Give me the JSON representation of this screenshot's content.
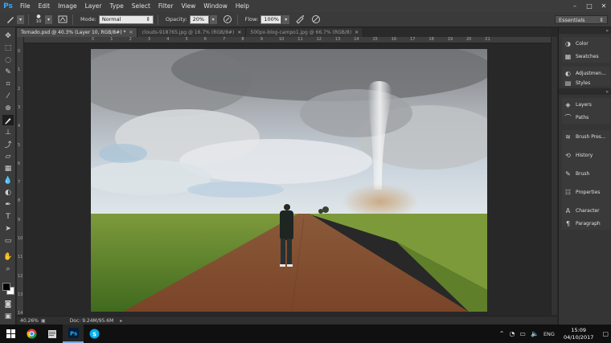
{
  "app": {
    "logo": "Ps"
  },
  "menu": [
    "File",
    "Edit",
    "Image",
    "Layer",
    "Type",
    "Select",
    "Filter",
    "View",
    "Window",
    "Help"
  ],
  "window_controls": [
    "minimize-icon",
    "maximize-icon",
    "close-icon"
  ],
  "options": {
    "brush_size": "10",
    "mode_label": "Mode:",
    "mode_value": "Normal",
    "opacity_label": "Opacity:",
    "opacity_value": "20%",
    "flow_label": "Flow:",
    "flow_value": "100%",
    "workspace": "Essentials"
  },
  "tabs": [
    {
      "label": "Tornado.psd @ 40.3% (Layer 10, RGB/8#) *",
      "active": true
    },
    {
      "label": "clouds-918765.jpg @ 16.7% (RGB/8#)",
      "active": false
    },
    {
      "label": "500px-blog-campo1.jpg @ 66.7% (RGB/8)",
      "active": false
    }
  ],
  "ruler_labels": [
    "0",
    "1",
    "2",
    "3",
    "4",
    "5",
    "6",
    "7",
    "8",
    "9",
    "10",
    "11",
    "12",
    "13",
    "14",
    "15",
    "16",
    "17",
    "18",
    "19",
    "20",
    "21"
  ],
  "status": {
    "zoom": "40.26%",
    "doc": "Doc: 9.24M/95.6M"
  },
  "panels": {
    "group1": [
      "Color",
      "Swatches"
    ],
    "group2": [
      "Adjustmen...",
      "Styles"
    ],
    "group3": [
      "Layers",
      "Paths"
    ],
    "group4": [
      "Brush Pres...",
      "History",
      "Brush",
      "Properties",
      "Character",
      "Paragraph"
    ]
  },
  "taskbar": {
    "apps": [
      "windows-start-icon",
      "chrome-icon",
      "file-explorer-icon",
      "photoshop-icon",
      "skype-icon"
    ],
    "language": "ENG",
    "time": "15:09",
    "date": "04/10/2017"
  },
  "colors": {
    "accent": "#31a8ff",
    "ui_dark": "#282828",
    "panel": "#353535"
  }
}
